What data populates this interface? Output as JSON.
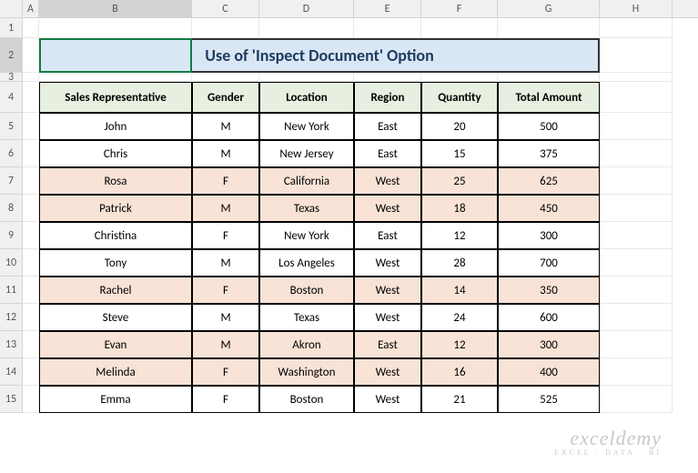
{
  "columns": [
    "A",
    "B",
    "C",
    "D",
    "E",
    "F",
    "G",
    "H"
  ],
  "title": "Use of 'Inspect Document' Option",
  "headers": [
    "Sales Representative",
    "Gender",
    "Location",
    "Region",
    "Quantity",
    "Total Amount"
  ],
  "rows_visible": [
    1,
    2,
    3,
    4,
    5,
    6,
    7,
    8,
    9,
    10,
    11,
    12,
    13,
    14,
    15
  ],
  "chart_data": {
    "type": "table",
    "title": "Use of 'Inspect Document' Option",
    "headers": [
      "Sales Representative",
      "Gender",
      "Location",
      "Region",
      "Quantity",
      "Total Amount"
    ],
    "rows": [
      {
        "rep": "John",
        "gender": "M",
        "location": "New York",
        "region": "East",
        "quantity": 20,
        "total": 500,
        "shaded": false
      },
      {
        "rep": "Chris",
        "gender": "M",
        "location": "New Jersey",
        "region": "East",
        "quantity": 15,
        "total": 375,
        "shaded": false
      },
      {
        "rep": "Rosa",
        "gender": "F",
        "location": "California",
        "region": "West",
        "quantity": 25,
        "total": 625,
        "shaded": true
      },
      {
        "rep": "Patrick",
        "gender": "M",
        "location": "Texas",
        "region": "West",
        "quantity": 18,
        "total": 450,
        "shaded": true
      },
      {
        "rep": "Christina",
        "gender": "F",
        "location": "New York",
        "region": "East",
        "quantity": 12,
        "total": 300,
        "shaded": false
      },
      {
        "rep": "Tony",
        "gender": "M",
        "location": "Los Angeles",
        "region": "West",
        "quantity": 28,
        "total": 700,
        "shaded": false
      },
      {
        "rep": "Rachel",
        "gender": "F",
        "location": "Boston",
        "region": "West",
        "quantity": 14,
        "total": 350,
        "shaded": true
      },
      {
        "rep": "Steve",
        "gender": "M",
        "location": "Texas",
        "region": "West",
        "quantity": 24,
        "total": 600,
        "shaded": false
      },
      {
        "rep": "Evan",
        "gender": "M",
        "location": "Akron",
        "region": "East",
        "quantity": 12,
        "total": 300,
        "shaded": true
      },
      {
        "rep": "Melinda",
        "gender": "F",
        "location": "Washington",
        "region": "West",
        "quantity": 16,
        "total": 400,
        "shaded": true
      },
      {
        "rep": "Emma",
        "gender": "F",
        "location": "Boston",
        "region": "West",
        "quantity": 21,
        "total": 525,
        "shaded": false
      }
    ]
  },
  "watermark": {
    "main": "exceldemy",
    "sub": "EXCEL · DATA · BI"
  }
}
